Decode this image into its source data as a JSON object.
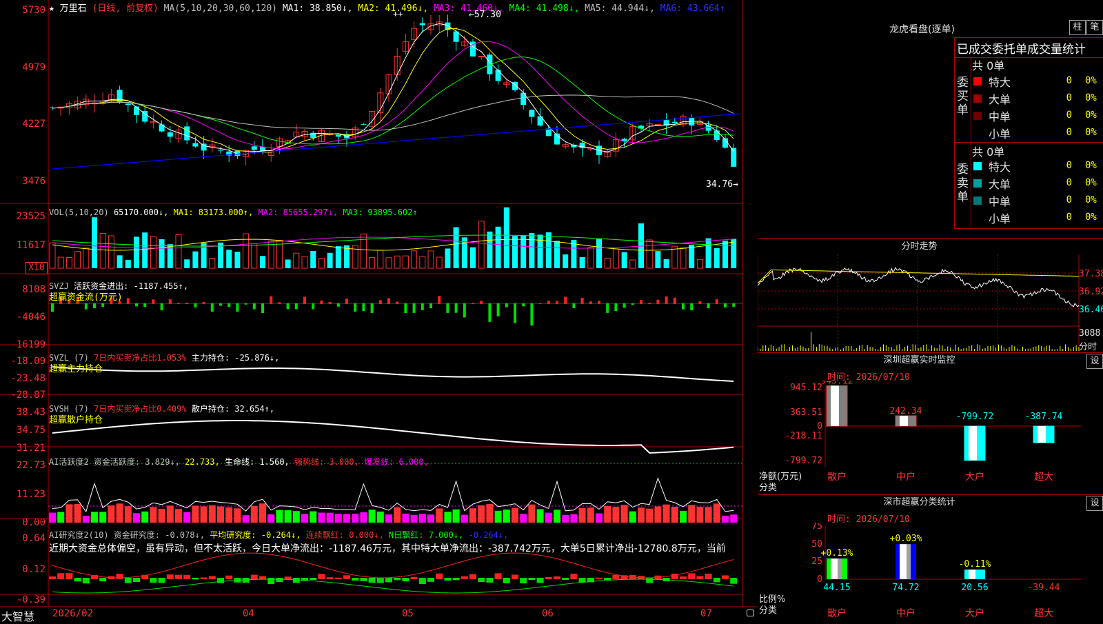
{
  "stock": {
    "name": "万里石",
    "mode": "(日线, 前复权)",
    "star": "★"
  },
  "colors": {
    "up": "#ff3232",
    "down": "#00ffff",
    "ma1": "#ffffff",
    "ma2": "#ffff00",
    "ma3": "#ff00ff",
    "ma4": "#00ff00",
    "ma5": "#c0c0c0",
    "ma6": "#0000ff",
    "border": "#b00000"
  },
  "price": {
    "ma_prefix": "MA(5,10,20,30,60,120)",
    "ma": [
      {
        "label": "MA1: 38.850↓,",
        "color": "#ffffff"
      },
      {
        "label": "MA2: 41.496↓,",
        "color": "#ffff00"
      },
      {
        "label": "MA3: 41.460↓,",
        "color": "#ff00ff"
      },
      {
        "label": "MA4: 41.498↓,",
        "color": "#00ff00"
      },
      {
        "label": "MA5: 44.944↓,",
        "color": "#c0c0c0"
      },
      {
        "label": "MA6: 43.664↑",
        "color": "#0000ff"
      }
    ],
    "yticks": [
      "5730",
      "4979",
      "4227",
      "3476"
    ],
    "high_label": "57.30",
    "low_label": "34.76",
    "marker": "++"
  },
  "vol": {
    "prefix": "VOL(5,10,20)",
    "value": "65170.000↓,",
    "ma1": "MA1: 83173.000↑,",
    "ma2": "MA2: 85655.297↓,",
    "ma3": "MA3: 93895.602↑",
    "yticks": [
      "23525",
      "11617"
    ],
    "unit": "X10"
  },
  "svzj": {
    "prefix": "SVZJ",
    "label": "活跃资金进出: -1187.455↑,",
    "sub": "超赢资金流(万元)",
    "yticks": [
      "8108",
      "-4046",
      "-16199"
    ]
  },
  "svzl": {
    "prefix": "SVZL (7)",
    "label1": "7日内买卖净占比1.053%",
    "label2": "主力持仓: -25.876↓,",
    "sub": "超赢主力持仓",
    "yticks": [
      "-18.09",
      "-23.48",
      "-28.87"
    ]
  },
  "svsh": {
    "prefix": "SVSH (7)",
    "label1": "7日内买卖净占比0.409%",
    "label2": "散户持仓: 32.654↑,",
    "sub": "超赢散户持仓",
    "yticks": [
      "38.43",
      "34.75",
      "31.21"
    ]
  },
  "ai_active": {
    "prefix": "AI活跃度2 资金活跃度: 3.829↓,",
    "v2": "22.733,",
    "v3": "生命线: 1.560,",
    "v4": "强势线: 3.000,",
    "v5": "爆发线: 6.000,",
    "yticks": [
      "22.73",
      "11.23",
      "0.00"
    ]
  },
  "ai_research": {
    "prefix": "AI研究度2(10) 资金研究度: -0.078↓,",
    "v2": "平均研究度: -0.264↓,",
    "v3": "连续飘红: 0.000↓,",
    "v4": "N日飘红: 7.000↓,",
    "v5": "-0.264↓,",
    "comment": "近期大资金总体偏空，虽有异动，但不太活跃，今日大单净流出：-1187.46万元，其中特大单净流出：-387.742万元，大单5日累计净出-12780.8万元，当前",
    "yticks": [
      "0.64",
      "0.12",
      "-0.39"
    ]
  },
  "xaxis": {
    "app": "大智慧",
    "labels": [
      "2026/02",
      "04",
      "05",
      "06",
      "07"
    ]
  },
  "dragon": {
    "title": "龙虎看盘(逐单)",
    "btn1": "柱",
    "btn2": "笔",
    "subtitle": "已成交委托单成交量统计",
    "buy": {
      "side_label": "委买单",
      "total": "共 0单",
      "rows": [
        {
          "name": "特大",
          "count": "0",
          "pct": "0%",
          "color": "#ff0000"
        },
        {
          "name": "大单",
          "count": "0",
          "pct": "0%",
          "color": "#a00000"
        },
        {
          "name": "中单",
          "count": "0",
          "pct": "0%",
          "color": "#700000"
        },
        {
          "name": "小单",
          "count": "0",
          "pct": "0%",
          "color": ""
        }
      ]
    },
    "sell": {
      "side_label": "委卖单",
      "total": "共 0单",
      "rows": [
        {
          "name": "特大",
          "count": "0",
          "pct": "0%",
          "color": "#00ffff"
        },
        {
          "name": "大单",
          "count": "0",
          "pct": "0%",
          "color": "#00a0a0"
        },
        {
          "name": "中单",
          "count": "0",
          "pct": "0%",
          "color": "#007878"
        },
        {
          "name": "小单",
          "count": "0",
          "pct": "0%",
          "color": ""
        }
      ]
    }
  },
  "intraday": {
    "title": "分时走势",
    "yticks": [
      "37.38",
      "36.92",
      "36.46"
    ],
    "vol_label": "3088",
    "vol_sub": "分时"
  },
  "monitor": {
    "title": "深圳超赢实时监控",
    "btn": "设",
    "time": "时间: 2026/07/10",
    "yticks": [
      "945.12",
      "363.51",
      "0",
      "-218.11",
      "-799.72"
    ],
    "ylabel": "净额(万元)",
    "xlabel": "分类",
    "categories": [
      "散户",
      "中户",
      "大户",
      "超大"
    ],
    "values": [
      945.12,
      242.34,
      -799.72,
      -387.74
    ],
    "value_labels": [
      "945.12",
      "242.34",
      "-799.72",
      "-387.74"
    ]
  },
  "classify": {
    "title": "深市超赢分类统计",
    "btn": "设",
    "time": "时间: 2026/07/10",
    "yticks": [
      "75",
      "50",
      "25",
      "0"
    ],
    "ylabel": "比例%",
    "xlabel": "分类",
    "categories": [
      "散户",
      "中户",
      "大户",
      "超大"
    ],
    "values": [
      44.15,
      74.72,
      20.56,
      -39.44
    ],
    "value_labels": [
      "44.15",
      "74.72",
      "20.56",
      "-39.44"
    ],
    "change_labels": [
      "+0.13%",
      "+0.03%",
      "-0.11%",
      ""
    ]
  },
  "chart_data": {
    "type": "candlestick",
    "x_labels": [
      "2026/02",
      "04",
      "05",
      "06",
      "07"
    ],
    "price_ticks": [
      57.3,
      49.79,
      42.27,
      34.76
    ],
    "high": 57.3,
    "low": 34.76,
    "ma_last": {
      "MA1": 38.85,
      "MA2": 41.496,
      "MA3": 41.46,
      "MA4": 41.498,
      "MA5": 44.944,
      "MA6": 43.664
    }
  }
}
